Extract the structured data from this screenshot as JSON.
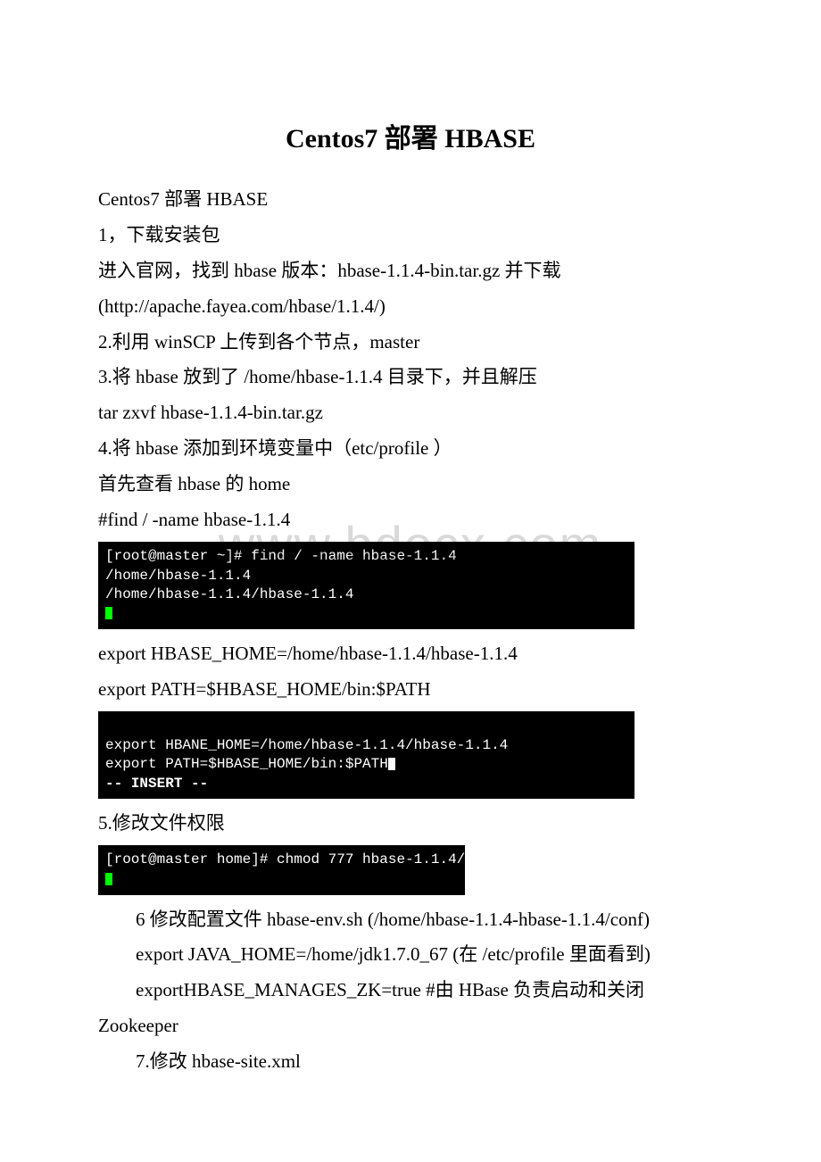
{
  "title": "Centos7 部署 HBASE",
  "watermark": "www.bdocx.com",
  "lines": {
    "l0": "Centos7 部署 HBASE",
    "l1": "1，下载安装包",
    "l2": "进入官网，找到 hbase 版本：hbase-1.1.4-bin.tar.gz 并下载",
    "l3": "(http://apache.fayea.com/hbase/1.1.4/)",
    "l4": "2.利用 winSCP 上传到各个节点，master",
    "l5": "3.将 hbase 放到了 /home/hbase-1.1.4 目录下，并且解压",
    "l6": "tar zxvf hbase-1.1.4-bin.tar.gz",
    "l7": "4.将 hbase 添加到环境变量中（etc/profile ）",
    "l8": "首先查看 hbase 的 home",
    "l9": "#find / -name hbase-1.1.4",
    "l10": "export HBASE_HOME=/home/hbase-1.1.4/hbase-1.1.4",
    "l11": "export PATH=$HBASE_HOME/bin:$PATH",
    "l12": "5.修改文件权限",
    "l13": "6 修改配置文件 hbase-env.sh (/home/hbase-1.1.4-hbase-1.1.4/conf)",
    "l14": "export JAVA_HOME=/home/jdk1.7.0_67 (在 /etc/profile 里面看到)",
    "l15": "exportHBASE_MANAGES_ZK=true    #由 HBase 负责启动和关闭 Zookeeper",
    "l16": "7.修改 hbase-site.xml"
  },
  "terminals": {
    "t1a": "[root@master ~]# find / -name hbase-1.1.4",
    "t1b": "/home/hbase-1.1.4",
    "t1c": "/home/hbase-1.1.4/hbase-1.1.4",
    "t2a": "export HBANE_HOME=/home/hbase-1.1.4/hbase-1.1.4",
    "t2b": "export PATH=$HBASE_HOME/bin:$PATH",
    "t2c": "-- INSERT --",
    "t3a": "[root@master home]# chmod 777 hbase-1.1.4/"
  }
}
